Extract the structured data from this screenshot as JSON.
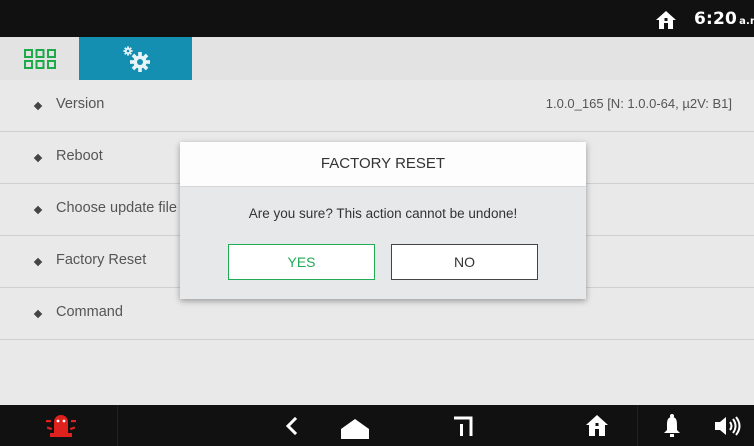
{
  "status_bar": {
    "icons": [
      "home-icon"
    ],
    "time": "6:20",
    "ampm": "a.m."
  },
  "tabs": [
    {
      "name": "apps-grid",
      "icon": "grid-icon",
      "active": false
    },
    {
      "name": "settings",
      "icon": "gear-icon",
      "active": true
    }
  ],
  "settings_list": {
    "items": [
      {
        "label": "Version",
        "value": "1.0.0_165 [N: 1.0.0-64, µ2V: B1]"
      },
      {
        "label": "Reboot",
        "value": ""
      },
      {
        "label": "Choose update file",
        "value": ""
      },
      {
        "label": "Factory Reset",
        "value": ""
      },
      {
        "label": "Command",
        "value": ""
      }
    ]
  },
  "dialog": {
    "title": "FACTORY RESET",
    "message": "Are you sure? This action cannot be undone!",
    "yes_label": "YES",
    "no_label": "NO"
  },
  "nav_bar": {
    "icons": [
      "alarm-icon",
      "back-icon",
      "home-nav-icon",
      "recent-icon",
      "house-icon",
      "bell-icon",
      "volume-icon"
    ]
  },
  "colors": {
    "accent": "#148fb1",
    "confirm": "#22aa55",
    "alarm": "#e0221f",
    "grid": "#1faa4a"
  }
}
